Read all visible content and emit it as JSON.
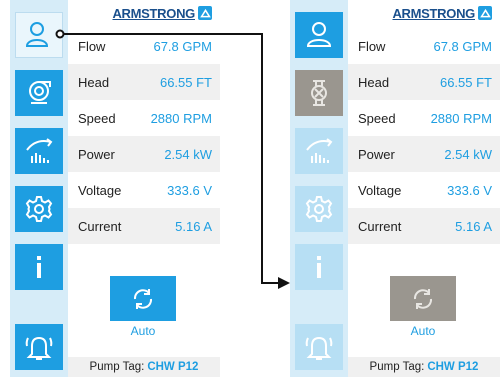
{
  "colors": {
    "accent": "#1e9ee1",
    "sidebar_bg": "#d6ecf8",
    "disabled": "#9a968f",
    "brand": "#1a4f8c"
  },
  "brand": {
    "name": "ARMSTRONG",
    "logo_icon": "armstrong-logo-icon"
  },
  "left_panel": {
    "nav": [
      {
        "icon": "user-icon",
        "state": "selected"
      },
      {
        "icon": "pump-icon",
        "state": "active"
      },
      {
        "icon": "chart-icon",
        "state": "active"
      },
      {
        "icon": "gear-icon",
        "state": "active"
      },
      {
        "icon": "info-icon",
        "state": "active"
      },
      {
        "icon": "bell-icon",
        "state": "active"
      }
    ],
    "readings": [
      {
        "label": "Flow",
        "value": "67.8 GPM"
      },
      {
        "label": "Head",
        "value": "66.55 FT"
      },
      {
        "label": "Speed",
        "value": "2880 RPM"
      },
      {
        "label": "Power",
        "value": "2.54 kW"
      },
      {
        "label": "Voltage",
        "value": "333.6 V"
      },
      {
        "label": "Current",
        "value": "5.16 A"
      }
    ],
    "mode": {
      "label": "Auto",
      "icon": "refresh-icon",
      "state": "enabled"
    },
    "pump_tag": {
      "label": "Pump Tag:",
      "value": "CHW P12"
    }
  },
  "right_panel": {
    "nav": [
      {
        "icon": "user-icon",
        "state": "selected"
      },
      {
        "icon": "valve-icon",
        "state": "disabled"
      },
      {
        "icon": "chart-icon",
        "state": "light"
      },
      {
        "icon": "gear-icon",
        "state": "light"
      },
      {
        "icon": "info-icon",
        "state": "light"
      },
      {
        "icon": "bell-icon",
        "state": "light"
      }
    ],
    "readings": [
      {
        "label": "Flow",
        "value": "67.8 GPM"
      },
      {
        "label": "Head",
        "value": "66.55 FT"
      },
      {
        "label": "Speed",
        "value": "2880 RPM"
      },
      {
        "label": "Power",
        "value": "2.54 kW"
      },
      {
        "label": "Voltage",
        "value": "333.6 V"
      },
      {
        "label": "Current",
        "value": "5.16 A"
      }
    ],
    "mode": {
      "label": "Auto",
      "icon": "refresh-icon",
      "state": "disabled"
    },
    "pump_tag": {
      "label": "Pump Tag:",
      "value": "CHW P12"
    }
  },
  "annotation": {
    "type": "arrow",
    "from": "left user button",
    "to": "right panel"
  }
}
